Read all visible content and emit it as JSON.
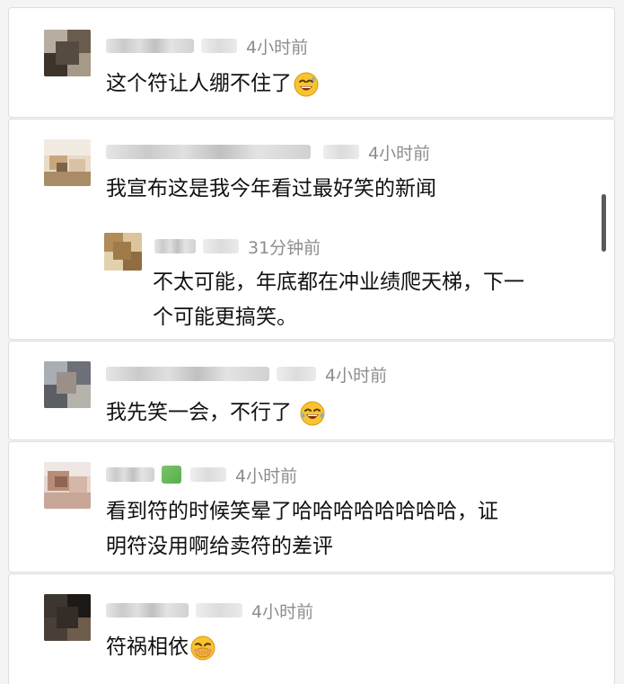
{
  "comments": [
    {
      "time": "4小时前",
      "text": "这个符让人绷不住了",
      "emoji": "sweat-smile-emoji"
    },
    {
      "time": "4小时前",
      "text": "我宣布这是我今年看过最好笑的新闻",
      "reply": {
        "time": "31分钟前",
        "text_line1": "不太可能，年底都在冲业绩爬天梯，下一",
        "text_line2": "个可能更搞笑。"
      }
    },
    {
      "time": "4小时前",
      "text": "我先笑一会，不行了",
      "emoji": "tears-of-joy-emoji"
    },
    {
      "time": "4小时前",
      "text_line1": "看到符的时候笑晕了哈哈哈哈哈哈哈哈，证",
      "text_line2": "明符没用啊给卖符的差评"
    },
    {
      "time": "4小时前",
      "text": "符祸相依",
      "emoji": "hand-over-mouth-emoji"
    }
  ]
}
